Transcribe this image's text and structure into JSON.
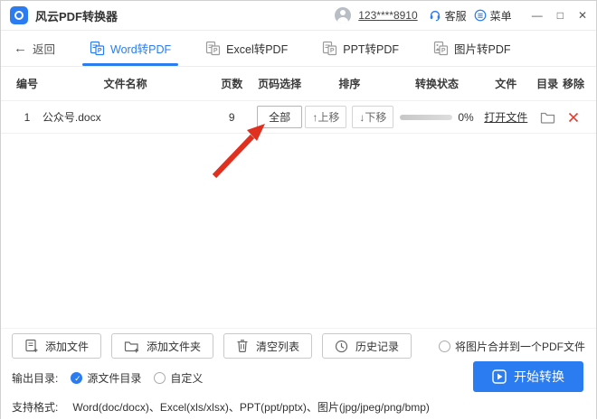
{
  "titlebar": {
    "app_title": "风云PDF转换器",
    "account": "123****8910",
    "service_label": "客服",
    "menu_label": "菜单",
    "minimize": "—",
    "maximize": "□",
    "close": "✕"
  },
  "nav": {
    "back_arrow": "←",
    "back_label": "返回",
    "tabs": [
      {
        "label": "Word转PDF",
        "active": true
      },
      {
        "label": "Excel转PDF",
        "active": false
      },
      {
        "label": "PPT转PDF",
        "active": false
      },
      {
        "label": "图片转PDF",
        "active": false
      }
    ]
  },
  "table": {
    "headers": [
      "编号",
      "文件名称",
      "页数",
      "页码选择",
      "排序",
      "转换状态",
      "文件",
      "目录",
      "移除"
    ],
    "rows": [
      {
        "index": "1",
        "filename": "公众号.docx",
        "pages": "9",
        "page_select_label": "全部",
        "move_up_label": "↑上移",
        "move_down_label": "↓下移",
        "progress_percent": "0%",
        "open_file_label": "打开文件"
      }
    ]
  },
  "toolbar": {
    "add_file_label": "添加文件",
    "add_folder_label": "添加文件夹",
    "clear_list_label": "清空列表",
    "history_label": "历史记录",
    "merge_option_label": "将图片合并到一个PDF文件"
  },
  "output": {
    "label": "输出目录:",
    "source_dir_label": "源文件目录",
    "custom_label": "自定义",
    "start_button_label": "开始转换"
  },
  "footer": {
    "label": "支持格式:",
    "formats": "Word(doc/docx)、Excel(xls/xlsx)、PPT(ppt/pptx)、图片(jpg/jpeg/png/bmp)"
  },
  "colors": {
    "accent": "#2b7cf0",
    "danger": "#e23b2e",
    "arrow": "#e03020"
  }
}
